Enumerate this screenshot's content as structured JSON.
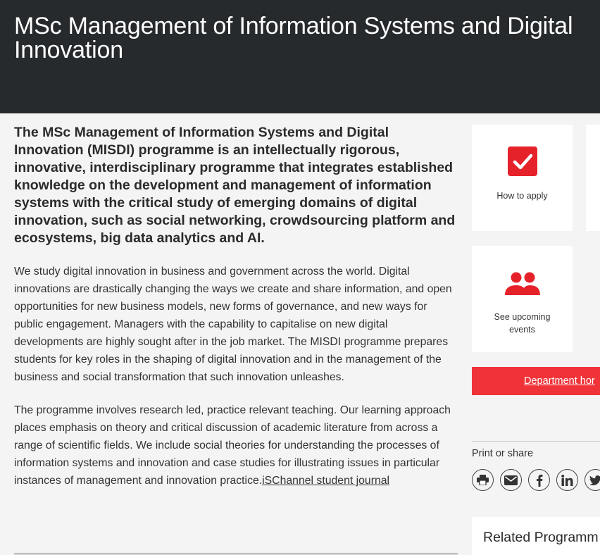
{
  "page": {
    "title": "MSc Management of Information Systems and Digital Innovation"
  },
  "main": {
    "intro": "The MSc Management of Information Systems and Digital Innovation (MISDI) programme is an intellectually rigorous, innovative, interdisciplinary programme that integrates established knowledge on the development and management of information systems with the critical study of emerging domains of digital innovation, such as social networking, crowdsourcing platform and ecosystems, big data analytics and AI.",
    "para1": "We study digital innovation in business and government across the world. Digital innovations are drastically changing the ways we create and share information, and open opportunities for new business models, new forms of governance, and new ways for public engagement. Managers with the capability to capitalise on new digital developments are highly sought after in the job market. The MISDI programme prepares students for key roles in the shaping of digital innovation and in the management of the business and social transformation that such innovation unleashes.",
    "para2": "The programme involves research led, practice relevant teaching. Our learning approach places emphasis on theory and critical discussion of academic literature from across a range of scientific fields. We include social theories for understanding the processes of information systems and innovation and case studies for illustrating issues in particular instances of management and innovation practice.",
    "para2_link": "iSChannel student journal"
  },
  "sidebar": {
    "cards": [
      {
        "label": "How to apply",
        "icon": "checkbox-icon"
      },
      {
        "label": "See upcoming events",
        "icon": "people-icon"
      }
    ],
    "department_button": "Department hor",
    "share_label": "Print or share",
    "share_icons": [
      "print-icon",
      "email-icon",
      "facebook-icon",
      "linkedin-icon",
      "twitter-icon"
    ],
    "related_title": "Related Programm"
  },
  "colors": {
    "header_bg": "#262a2d",
    "accent_red": "#e5212a",
    "button_red": "#ef3339",
    "page_bg": "#f4f4f4"
  }
}
